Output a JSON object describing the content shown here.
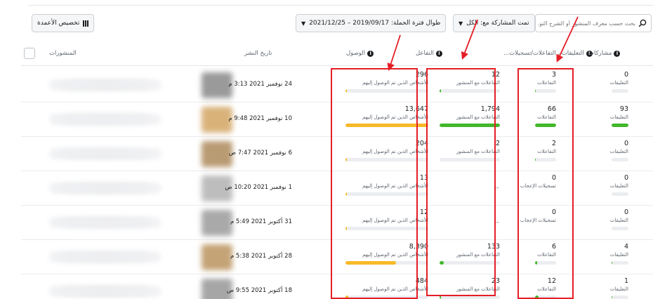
{
  "toolbar": {
    "customize_columns": "تخصيص الأعمدة",
    "date_range": "طوال فترة الحملة: 2019/09/17 – 2021/12/25",
    "sort": "تمت المشاركة مع: الكل",
    "search_placeholder": "بحث حسب معرف المنشور أو الشرح التو..."
  },
  "columns": {
    "posts": "المنشورات",
    "publish_date": "تاريخ النشر",
    "reach": "الوصول",
    "engagement": "التفاعل",
    "reactions": "التعليقات ، التفاعلات/تسجيلات...",
    "shares": "مشاركات"
  },
  "colors": {
    "accent_yellow": "#f7b928",
    "accent_green": "#42b72a",
    "annotation_red": "#e41e26"
  },
  "rows": [
    {
      "date": "24 نوفمبر 2021 3:13 م",
      "reach": "296",
      "reach_label": "الأشخاص الذين تم الوصول إليهم",
      "reach_pct": 2,
      "eng": "12",
      "eng_label": "التفاعلات مع المنشور",
      "eng_pct": 1,
      "react": "3",
      "react_label": "التفاعلات",
      "react_pct": 3,
      "share": "0",
      "share_label": "التعليقات",
      "share_pct": 0,
      "thumb": "#9a9a9a"
    },
    {
      "date": "10 نوفمبر 2021 9:48 م",
      "reach": "13,647",
      "reach_label": "الأشخاص الذين تم الوصول إليهم",
      "reach_pct": 100,
      "eng": "1,794",
      "eng_label": "التفاعلات مع المنشور",
      "eng_pct": 100,
      "react": "66",
      "react_label": "التفاعلات",
      "react_pct": 100,
      "share": "93",
      "share_label": "التعليقات",
      "share_pct": 100,
      "thumb": "#d9b27a"
    },
    {
      "date": "6 نوفمبر 2021 7:47 ص",
      "reach": "204",
      "reach_label": "الأشخاص الذين تم الوصول إليهم",
      "reach_pct": 2,
      "eng": "2",
      "eng_label": "التفاعلات مع المنشور",
      "eng_pct": 0,
      "react": "2",
      "react_label": "التفاعلات",
      "react_pct": 3,
      "share": "0",
      "share_label": "التعليقات",
      "share_pct": 0,
      "thumb": "#b99b73"
    },
    {
      "date": "1 نوفمبر 2021 10:20 ص",
      "reach": "13",
      "reach_label": "الأشخاص الذين تم الوصول إليهم",
      "reach_pct": 1,
      "eng": "--",
      "eng_label": "",
      "eng_pct": -1,
      "react": "0",
      "react_label": "تسجيلات الإعجاب",
      "react_pct": -1,
      "share": "0",
      "share_label": "التعليقات",
      "share_pct": 0,
      "thumb": "#bdbdbd"
    },
    {
      "date": "31 أكتوبر 2021 5:49 م",
      "reach": "12",
      "reach_label": "الأشخاص الذين تم الوصول إليهم",
      "reach_pct": 1,
      "eng": "--",
      "eng_label": "",
      "eng_pct": -1,
      "react": "0",
      "react_label": "تسجيلات الإعجاب",
      "react_pct": -1,
      "share": "0",
      "share_label": "التعليقات",
      "share_pct": 0,
      "thumb": "#a9a9a9"
    },
    {
      "date": "28 أكتوبر 2021 5:38 م",
      "reach": "8,390",
      "reach_label": "الأشخاص الذين تم الوصول إليهم",
      "reach_pct": 61,
      "eng": "133",
      "eng_label": "التفاعلات مع المنشور",
      "eng_pct": 7,
      "react": "6",
      "react_label": "التفاعلات",
      "react_pct": 9,
      "share": "4",
      "share_label": "التعليقات",
      "share_pct": 4,
      "thumb": "#c4a376"
    },
    {
      "date": "18 أكتوبر 2021 9:55 ص",
      "reach": "484",
      "reach_label": "الأشخاص الذين تم الوصول إليهم",
      "reach_pct": 3,
      "eng": "23",
      "eng_label": "التفاعلات مع المنشور",
      "eng_pct": 1,
      "react": "12",
      "react_label": "التفاعلات",
      "react_pct": 18,
      "share": "1",
      "share_label": "التعليقات",
      "share_pct": 1,
      "thumb": "#a6a6a6"
    }
  ]
}
